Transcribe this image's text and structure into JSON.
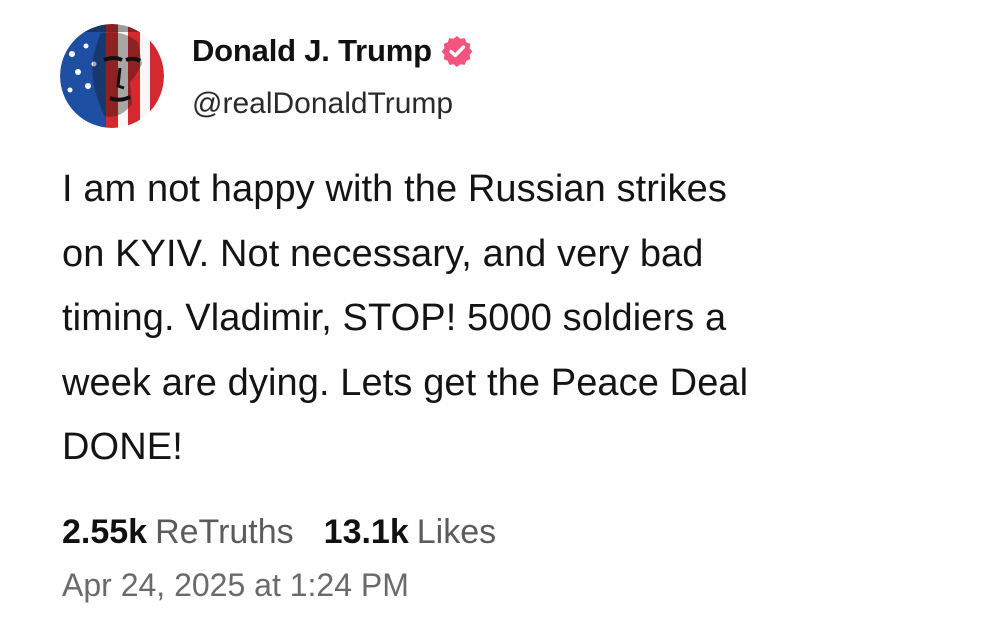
{
  "author": {
    "display_name": "Donald J. Trump",
    "handle": "@realDonaldTrump",
    "verified": true,
    "verified_color": "#f2547d",
    "avatar_icon": "flag-painted-portrait"
  },
  "post": {
    "lines": [
      "I am not happy with the Russian strikes",
      "on KYIV. Not necessary, and very bad",
      "timing. Vladimir, STOP! 5000 soldiers a",
      "week are dying. Lets get the Peace Deal",
      "DONE!"
    ]
  },
  "stats": {
    "retruths_count": "2.55k",
    "retruths_label": "ReTruths",
    "likes_count": "13.1k",
    "likes_label": "Likes"
  },
  "timestamp": "Apr 24, 2025 at 1:24 PM"
}
